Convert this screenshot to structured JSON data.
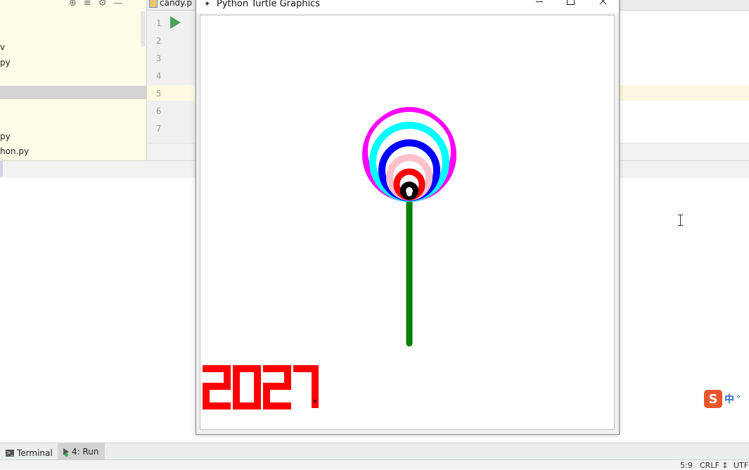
{
  "ide": {
    "project_panel": {
      "toolbar_icons": [
        "locate-icon",
        "collapse-icon",
        "gear-icon",
        "minimize-icon"
      ],
      "items": [
        {
          "label": "v"
        },
        {
          "label": "py"
        },
        {
          "label": "py"
        },
        {
          "label": "hon.py"
        }
      ]
    },
    "editor": {
      "tab_label": "candy.p",
      "line_numbers": [
        "1",
        "2",
        "3",
        "4",
        "5",
        "6",
        "7"
      ],
      "run_gutter_icon": "run-arrow-icon"
    },
    "tool_windows": {
      "terminal_label": "Terminal",
      "run_label": "4: Run"
    },
    "status_bar": {
      "position": "5:9",
      "line_separator": "CRLF ↕",
      "encoding": "UTF"
    },
    "ime": {
      "logo": "S",
      "mode": "中",
      "dot": "°"
    }
  },
  "turtle_window": {
    "title": "Python Turtle Graphics",
    "controls": {
      "minimize": "minimize-icon",
      "maximize": "maximize-icon",
      "close": "close-icon"
    },
    "drawing": {
      "year_text": "2027",
      "colors": {
        "ring_1": "#ff00ff",
        "ring_2": "#00ffff",
        "ring_3": "#0000ff",
        "ring_4": "#ffc0cb",
        "ring_5": "#ff0000",
        "ring_6": "#000000",
        "stick": "#008000",
        "year": "#ff0000"
      }
    }
  }
}
